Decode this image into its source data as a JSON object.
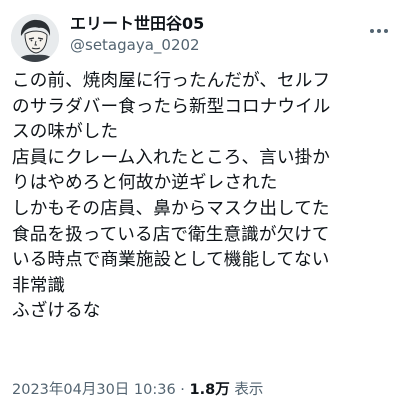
{
  "author": {
    "display_name": "エリート世田谷05",
    "handle": "@setagaya_0202"
  },
  "tweet": {
    "lines": [
      "この前、焼肉屋に行ったんだが、セルフ",
      "のサラダバー食ったら新型コロナウイル",
      "スの味がした",
      "店員にクレーム入れたところ、言い掛か",
      "りはやめろと何故か逆ギレされた",
      "しかもその店員、鼻からマスク出してた",
      "食品を扱っている店で衛生意識が欠けて",
      "いる時点で商業施設として機能してない",
      "非常識",
      "ふざけるな"
    ],
    "timestamp": "2023年04月30日 10:36",
    "separator": " · ",
    "views_count": "1.8万",
    "views_label": " 表示"
  },
  "icons": {
    "avatar": "avatar-illustration",
    "more": "more-options-icon"
  }
}
